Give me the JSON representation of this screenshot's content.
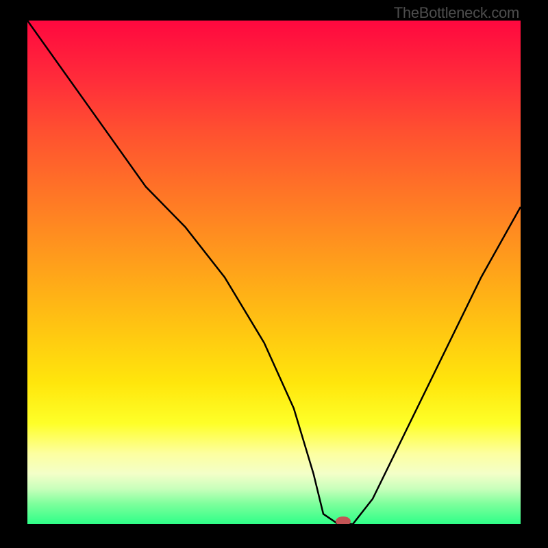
{
  "attribution": "TheBottleneck.com",
  "chart_data": {
    "type": "line",
    "title": "",
    "xlabel": "",
    "ylabel": "",
    "xlim": [
      0,
      100
    ],
    "ylim": [
      0,
      100
    ],
    "series": [
      {
        "name": "bottleneck-curve",
        "x": [
          0,
          8,
          16,
          24,
          32,
          40,
          48,
          54,
          58,
          60,
          63,
          66,
          70,
          76,
          84,
          92,
          100
        ],
        "y": [
          100,
          89,
          78,
          67,
          59,
          49,
          36,
          23,
          10,
          2,
          0,
          0,
          5,
          17,
          33,
          49,
          63
        ]
      }
    ],
    "marker": {
      "name": "optimal-point",
      "x": 64,
      "y": 0.4,
      "color": "#c35455"
    },
    "gradient_stops": [
      {
        "pos": 0,
        "color": "#ff083f"
      },
      {
        "pos": 12,
        "color": "#ff2d3a"
      },
      {
        "pos": 22,
        "color": "#ff5030"
      },
      {
        "pos": 32,
        "color": "#ff6e28"
      },
      {
        "pos": 42,
        "color": "#ff8c20"
      },
      {
        "pos": 52,
        "color": "#ffaa18"
      },
      {
        "pos": 62,
        "color": "#ffc811"
      },
      {
        "pos": 72,
        "color": "#ffe60c"
      },
      {
        "pos": 80,
        "color": "#feff28"
      },
      {
        "pos": 86,
        "color": "#fdffa0"
      },
      {
        "pos": 90,
        "color": "#f3ffc8"
      },
      {
        "pos": 93,
        "color": "#c8ffbb"
      },
      {
        "pos": 96,
        "color": "#7dff9c"
      },
      {
        "pos": 100,
        "color": "#2fff88"
      }
    ]
  }
}
